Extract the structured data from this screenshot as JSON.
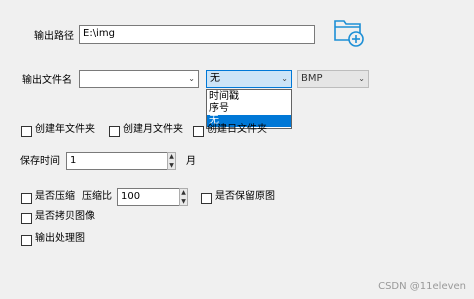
{
  "output_path": {
    "label": "输出路径",
    "value": "E:\\img"
  },
  "output_filename": {
    "label": "输出文件名",
    "name_value": "",
    "suffix_selected": "无",
    "suffix_options": [
      "时间戳",
      "序号",
      "无"
    ],
    "format_value": "BMP"
  },
  "checkboxes": {
    "year_folder": "创建年文件夹",
    "month_folder": "创建月文件夹",
    "day_folder": "创建日文件夹"
  },
  "retention": {
    "label": "保存时间",
    "value": "1",
    "unit": "月"
  },
  "compression": {
    "compress_label": "是否压缩",
    "ratio_label": "压缩比",
    "ratio_value": "100",
    "keep_original_label": "是否保留原图"
  },
  "copy_image_label": "是否拷贝图像",
  "output_processed_label": "输出处理图",
  "watermark": "CSDN @11eleven",
  "colors": {
    "accent": "#0078d7",
    "folder_icon": "#1d8fd6"
  }
}
